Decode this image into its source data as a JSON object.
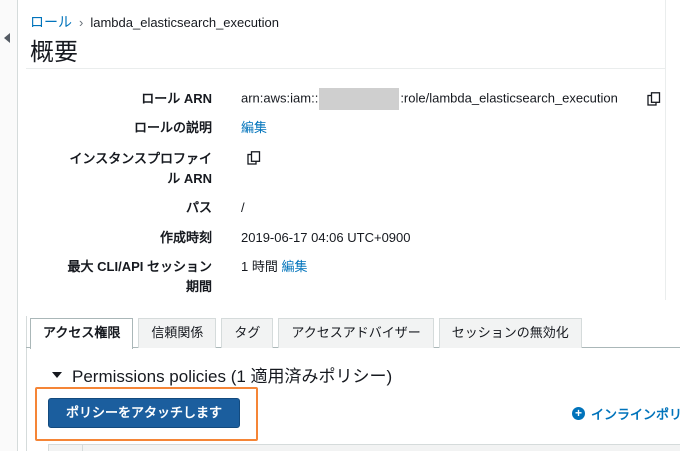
{
  "breadcrumb": {
    "root": "ロール",
    "separator": "›",
    "current": "lambda_elasticsearch_execution"
  },
  "page": {
    "title": "概要"
  },
  "summary": {
    "role_arn": {
      "label": "ロール ARN",
      "prefix": "arn:aws:iam::",
      "suffix": ":role/lambda_elasticsearch_execution"
    },
    "role_description": {
      "label": "ロールの説明",
      "edit_link": "編集"
    },
    "instance_profile_arn": {
      "label_line1": "インスタンスプロファイ",
      "label_line2": "ル ARN"
    },
    "path": {
      "label": "パス",
      "value": "/"
    },
    "creation_time": {
      "label": "作成時刻",
      "value": "2019-06-17 04:06 UTC+0900"
    },
    "max_session": {
      "label_line1": "最大 CLI/API セッション",
      "label_line2": "期間",
      "value": "1 時間",
      "edit_link": "編集"
    }
  },
  "tabs": [
    {
      "label": "アクセス権限",
      "active": true
    },
    {
      "label": "信頼関係",
      "active": false
    },
    {
      "label": "タグ",
      "active": false
    },
    {
      "label": "アクセスアドバイザー",
      "active": false
    },
    {
      "label": "セッションの無効化",
      "active": false
    }
  ],
  "permissions": {
    "section_title": "Permissions policies (1 適用済みポリシー)",
    "attach_button": "ポリシーをアタッチします",
    "inline_policy_link": "インラインポリ"
  },
  "colors": {
    "link": "#0073bb",
    "primary_button": "#1b5e9e",
    "highlight": "#f58536"
  },
  "icons": [
    "collapse-left-icon",
    "copy-icon",
    "caret-down-icon",
    "plus-circle-icon"
  ]
}
